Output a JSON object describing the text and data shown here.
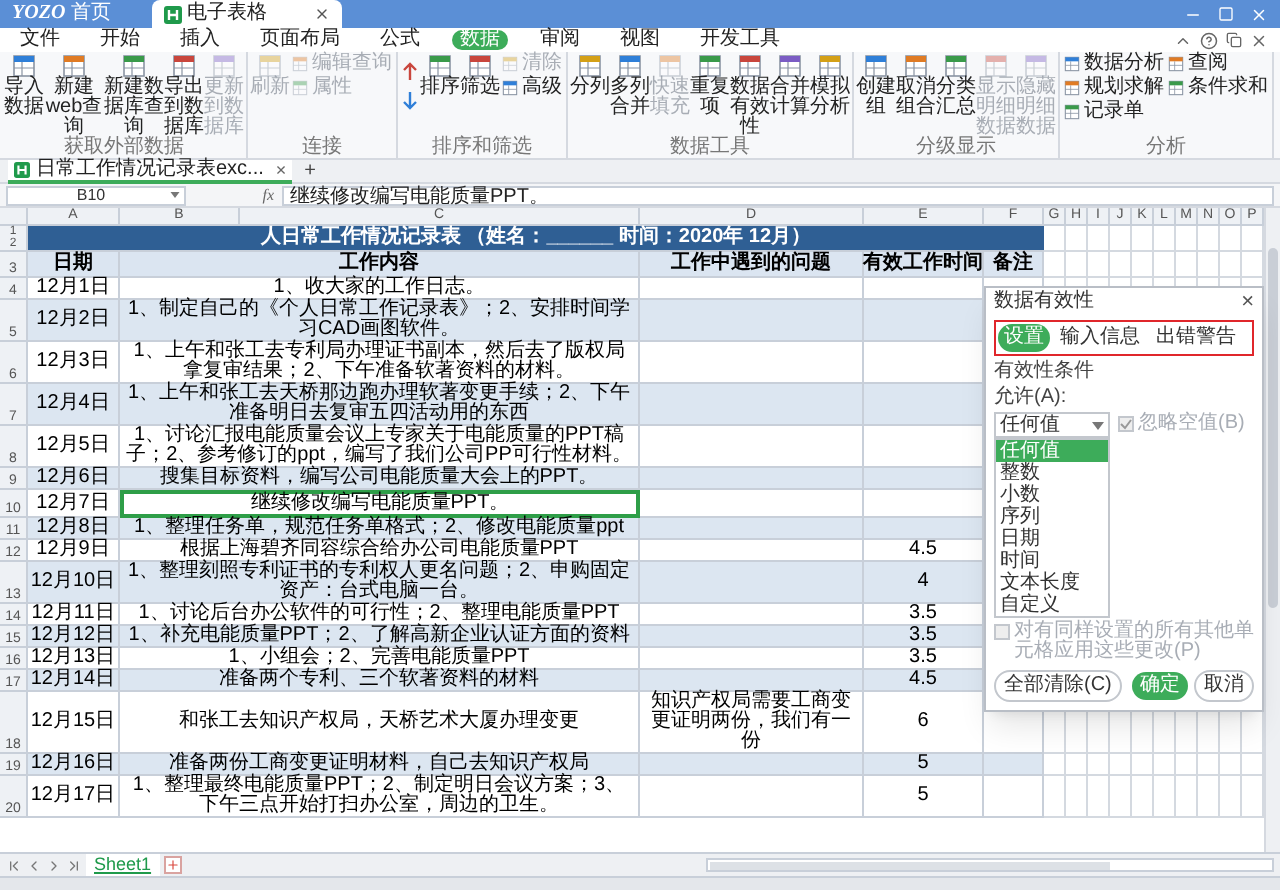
{
  "titlebar": {
    "logo": "YOZO",
    "home": "首页",
    "tab": "电子表格"
  },
  "menu": [
    {
      "label": "文件",
      "selected": false
    },
    {
      "label": "开始",
      "selected": false
    },
    {
      "label": "插入",
      "selected": false
    },
    {
      "label": "页面布局",
      "selected": false
    },
    {
      "label": "公式",
      "selected": false
    },
    {
      "label": "数据",
      "selected": true
    },
    {
      "label": "审阅",
      "selected": false
    },
    {
      "label": "视图",
      "selected": false
    },
    {
      "label": "开发工具",
      "selected": false
    }
  ],
  "ribbon": [
    {
      "label": "获取外部数据",
      "items": [
        {
          "kind": "big",
          "label": "导入数据",
          "disabled": false
        },
        {
          "kind": "big",
          "label": "新建web查询",
          "disabled": false
        },
        {
          "kind": "big",
          "label": "新建数据库查询",
          "disabled": false
        },
        {
          "kind": "big",
          "label": "导出到数据库",
          "disabled": false
        },
        {
          "kind": "big",
          "label": "更新到数据库",
          "disabled": true
        }
      ]
    },
    {
      "label": "连接",
      "items": [
        {
          "kind": "big",
          "label": "刷新",
          "disabled": true
        },
        {
          "kind": "stack",
          "items": [
            {
              "label": "编辑查询",
              "disabled": true
            },
            {
              "label": "属性",
              "disabled": true
            }
          ]
        }
      ]
    },
    {
      "label": "排序和筛选",
      "items": [
        {
          "kind": "sortpair"
        },
        {
          "kind": "big",
          "label": "排序",
          "disabled": false
        },
        {
          "kind": "big",
          "label": "筛选",
          "disabled": false
        },
        {
          "kind": "stack",
          "items": [
            {
              "label": "清除",
              "disabled": true
            },
            {
              "label": "高级",
              "disabled": false
            }
          ]
        }
      ]
    },
    {
      "label": "数据工具",
      "items": [
        {
          "kind": "big",
          "label": "分列",
          "disabled": false
        },
        {
          "kind": "big",
          "label": "多列合并",
          "disabled": false
        },
        {
          "kind": "big",
          "label": "快速填充",
          "disabled": true
        },
        {
          "kind": "big",
          "label": "重复项",
          "disabled": false
        },
        {
          "kind": "big",
          "label": "数据有效性",
          "disabled": false
        },
        {
          "kind": "big",
          "label": "合并计算",
          "disabled": false
        },
        {
          "kind": "big",
          "label": "模拟分析",
          "disabled": false
        }
      ]
    },
    {
      "label": "分级显示",
      "items": [
        {
          "kind": "big",
          "label": "创建组",
          "disabled": false
        },
        {
          "kind": "big",
          "label": "取消组合",
          "disabled": false
        },
        {
          "kind": "big",
          "label": "分类汇总",
          "disabled": false
        },
        {
          "kind": "big",
          "label": "显示明细数据",
          "disabled": true
        },
        {
          "kind": "big",
          "label": "隐藏明细数据",
          "disabled": true
        }
      ]
    },
    {
      "label": "分析",
      "items": [
        {
          "kind": "stack",
          "items": [
            {
              "label": "数据分析",
              "disabled": false
            },
            {
              "label": "规划求解",
              "disabled": false
            },
            {
              "label": "记录单",
              "disabled": false
            }
          ]
        },
        {
          "kind": "stack",
          "items": [
            {
              "label": "查阅",
              "disabled": false
            },
            {
              "label": "条件求和",
              "disabled": false
            }
          ]
        }
      ]
    }
  ],
  "document_tab": {
    "label": "日常工作情况记录表exc...",
    "close": "×",
    "add": "+"
  },
  "formula_bar": {
    "cell": "B10",
    "fx": "fx",
    "value": "继续修改编写电能质量PPT。"
  },
  "sheet": {
    "columns": [
      "A",
      "B",
      "C",
      "D",
      "E",
      "F",
      "G",
      "H",
      "I",
      "J",
      "K",
      "L",
      "M",
      "N",
      "O",
      "P"
    ],
    "title_row_numbers": [
      "1",
      "2"
    ],
    "title": "人日常工作情况记录表 （姓名：______ 时间：2020年 12月）",
    "header_row_number": "3",
    "headers": [
      "日期",
      "工作内容",
      "工作中遇到的问题",
      "有效工作时间",
      "备注"
    ],
    "rows": [
      {
        "number": "4",
        "date": "12月1日",
        "content": "1、收大家的工作日志。",
        "selected": false
      },
      {
        "number": "5",
        "date": "12月2日",
        "content": "1、制定自己的《个人日常工作记录表》；2、安排时间学习CAD画图软件。",
        "selected": false
      },
      {
        "number": "6",
        "date": "12月3日",
        "content": "1、上午和张工去专利局办理证书副本，然后去了版权局拿复审结果；2、下午准备软著资料的材料。",
        "selected": false
      },
      {
        "number": "7",
        "date": "12月4日",
        "content": "1、上午和张工去天桥那边跑办理软著变更手续；2、下午准备明日去复审五四活动用的东西",
        "selected": false
      },
      {
        "number": "8",
        "date": "12月5日",
        "content": "1、讨论汇报电能质量会议上专家关于电能质量的PPT稿子；2、参考修订的ppt，编写了我们公司PP可行性材料。",
        "selected": false
      },
      {
        "number": "9",
        "date": "12月6日",
        "content": "搜集目标资料，编写公司电能质量大会上的PPT。",
        "selected": false
      },
      {
        "number": "10",
        "date": "12月7日",
        "content": "继续修改编写电能质量PPT。",
        "selected": true
      },
      {
        "number": "11",
        "date": "12月8日",
        "content": "1、整理任务单，规范任务单格式；2、修改电能质量ppt",
        "selected": false
      },
      {
        "number": "12",
        "date": "12月9日",
        "content": "根据上海碧齐同容综合给办公司电能质量PPT",
        "hours": "4.5",
        "selected": false
      },
      {
        "number": "13",
        "date": "12月10日",
        "content": "1、整理刻照专利证书的专利权人更名问题；2、申购固定资产：台式电脑一台。",
        "hours": "4",
        "selected": false
      },
      {
        "number": "14",
        "date": "12月11日",
        "content": "1、讨论后台办公软件的可行性；2、整理电能质量PPT",
        "hours": "3.5",
        "selected": false
      },
      {
        "number": "15",
        "date": "12月12日",
        "content": "1、补充电能质量PPT；2、了解高新企业认证方面的资料",
        "hours": "3.5",
        "selected": false
      },
      {
        "number": "16",
        "date": "12月13日",
        "content": "1、小组会；2、完善电能质量PPT",
        "hours": "3.5",
        "selected": false
      },
      {
        "number": "17",
        "date": "12月14日",
        "content": "准备两个专利、三个软著资料的材料",
        "hours": "4.5",
        "selected": false
      },
      {
        "number": "18",
        "date": "12月15日",
        "content": "和张工去知识产权局，天桥艺术大厦办理变更",
        "problem": "知识产权局需要工商变更证明两份，我们有一份",
        "hours": "6",
        "selected": false
      },
      {
        "number": "19",
        "date": "12月16日",
        "content": "准备两份工商变更证明材料，自己去知识产权局",
        "hours": "5",
        "selected": false
      },
      {
        "number": "20",
        "date": "12月17日",
        "content": "1、整理最终电能质量PPT；2、制定明日会议方案；3、下午三点开始打扫办公室，周边的卫生。",
        "hours": "5",
        "selected": false
      }
    ]
  },
  "dialog": {
    "title": "数据有效性",
    "close": "×",
    "tabs_highlighted": true,
    "tabs": [
      {
        "label": "设置",
        "selected": true
      },
      {
        "label": "输入信息",
        "selected": false
      },
      {
        "label": "出错警告",
        "selected": false
      }
    ],
    "section": "有效性条件",
    "allow_label": "允许(A):",
    "allow_value": "任何值",
    "options": [
      {
        "label": "任何值",
        "selected": true
      },
      {
        "label": "整数",
        "selected": false
      },
      {
        "label": "小数",
        "selected": false
      },
      {
        "label": "序列",
        "selected": false
      },
      {
        "label": "日期",
        "selected": false
      },
      {
        "label": "时间",
        "selected": false
      },
      {
        "label": "文本长度",
        "selected": false
      },
      {
        "label": "自定义",
        "selected": false
      }
    ],
    "ignore_blank": {
      "label": "忽略空值(B)",
      "checked": true,
      "disabled": true
    },
    "apply_all": {
      "label": "对有同样设置的所有其他单元格应用这些更改(P)",
      "checked": false,
      "disabled": true
    },
    "buttons": [
      {
        "label": "全部清除(C)",
        "kind": "secondary"
      },
      {
        "label": "确定",
        "kind": "primary"
      },
      {
        "label": "取消",
        "kind": "secondary"
      }
    ]
  },
  "sheet_tabs": [
    {
      "label": "Sheet1",
      "selected": true
    }
  ]
}
